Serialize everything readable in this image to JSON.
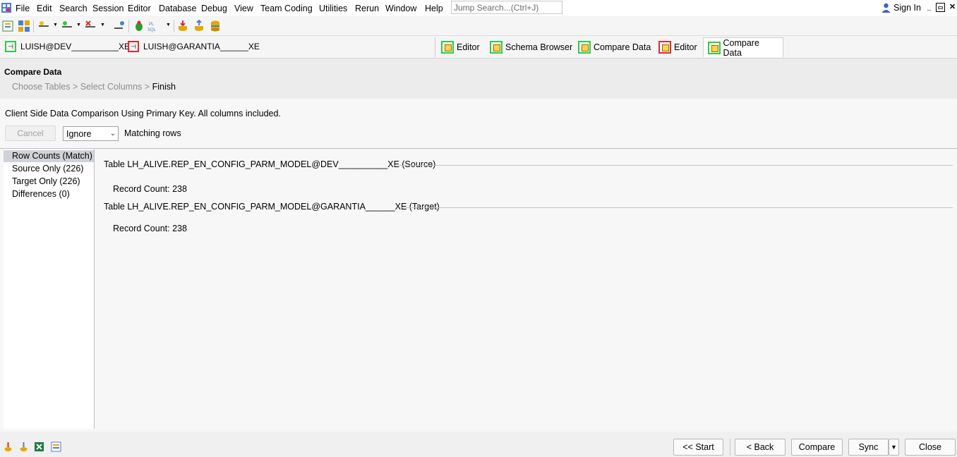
{
  "menu": [
    "File",
    "Edit",
    "Search",
    "Session",
    "Editor",
    "Database",
    "Debug",
    "View",
    "Team Coding",
    "Utilities",
    "Rerun",
    "Window",
    "Help"
  ],
  "jump_search": {
    "placeholder": "Jump Search...(Ctrl+J)"
  },
  "sign_in": "Sign In",
  "connections": [
    {
      "label": "LUISH@DEV__________XE",
      "color": "#2ecc40"
    },
    {
      "label": "LUISH@GARANTIA______XE",
      "color": "#e0282e"
    }
  ],
  "doc_tabs": [
    {
      "label": "Editor",
      "color": "#2ecc40"
    },
    {
      "label": "Schema Browser",
      "color": "#2ecc40"
    },
    {
      "label": "Compare Data",
      "color": "#2ecc40"
    },
    {
      "label": "Editor",
      "color": "#e0282e"
    },
    {
      "label": "Compare Data",
      "color": "#2ecc40"
    }
  ],
  "wizard": {
    "title": "Compare Data",
    "steps": [
      "Choose Tables",
      "Select Columns",
      "Finish"
    ],
    "separator": ">"
  },
  "description": "Client Side Data Comparison Using Primary Key.  All columns included.",
  "controls": {
    "cancel": "Cancel",
    "ignore_value": "Ignore",
    "matching_label": "Matching rows"
  },
  "results_list": [
    "Row Counts (Match)",
    "Source Only (226)",
    "Target Only (226)",
    "Differences (0)"
  ],
  "tables": [
    {
      "header": "Table LH_ALIVE.REP_EN_CONFIG_PARM_MODEL@DEV__________XE (Source)",
      "record_count": "Record Count: 238"
    },
    {
      "header": "Table LH_ALIVE.REP_EN_CONFIG_PARM_MODEL@GARANTIA______XE (Target)",
      "record_count": "Record Count: 238"
    }
  ],
  "buttons": {
    "start": "<< Start",
    "back": "< Back",
    "compare": "Compare",
    "sync": "Sync",
    "close": "Close"
  }
}
